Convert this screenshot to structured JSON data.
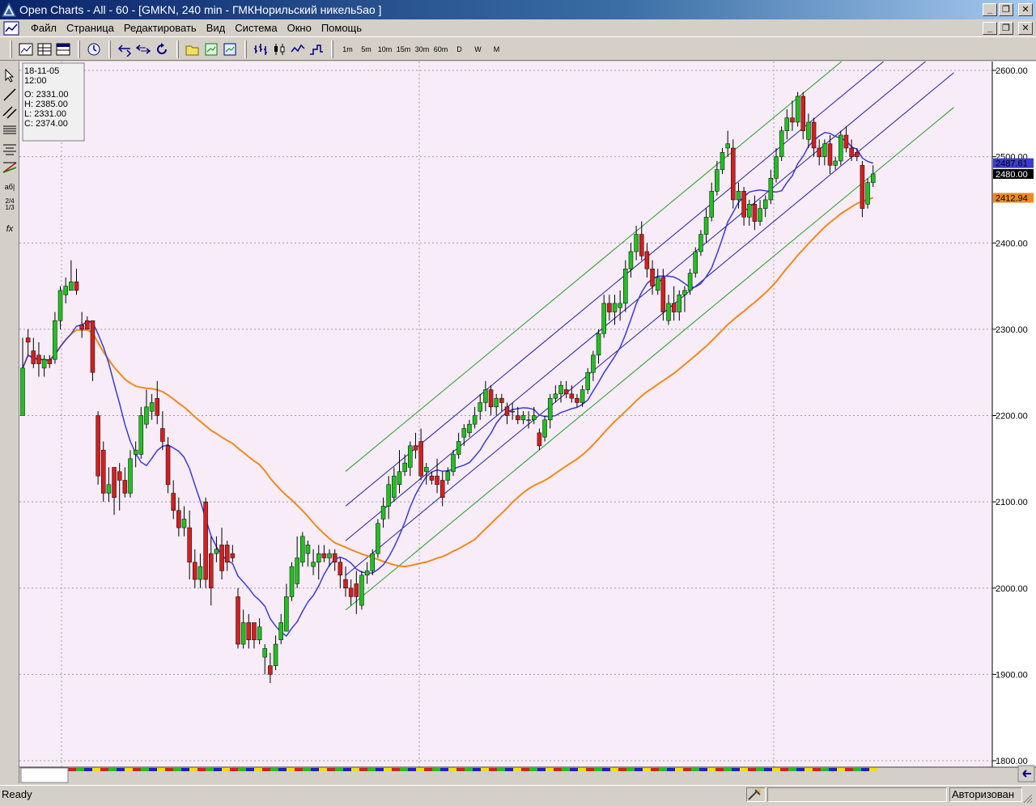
{
  "window": {
    "title": "Open Charts - All - 60 - [GMKN, 240 min - ГМКНорильский никель5ао ]"
  },
  "menu": {
    "items": [
      "Файл",
      "Страница",
      "Редактировать",
      "Вид",
      "Система",
      "Окно",
      "Помощь"
    ]
  },
  "toolbar": {
    "timeframes": [
      "1m",
      "5m",
      "10m",
      "15m",
      "30m",
      "60m",
      "D",
      "W",
      "M"
    ]
  },
  "lefttools": {
    "text_tool_label": "аб|",
    "fib_tool_label": "2/4\n1/3",
    "func_tool_label": "fx"
  },
  "ohlc_box": {
    "date": "18-11-05",
    "time": "12:00",
    "open": "O: 2331.00",
    "high": "H: 2385.00",
    "low": "L: 2331.00",
    "close": "C: 2374.00"
  },
  "price_labels": {
    "blue_ma": "2487.61",
    "last_price": "2480.00",
    "orange_ma": "2412.94"
  },
  "status": {
    "ready": "Ready",
    "auth": "Авторизован"
  },
  "chart_data": {
    "type": "candlestick",
    "ylim": [
      1800,
      2610
    ],
    "y_ticks": [
      "2600.00",
      "2500.00",
      "2400.00",
      "2300.00",
      "2200.00",
      "2100.00",
      "2000.00",
      "1900.00",
      "1800.00"
    ],
    "colors": {
      "up": "#22c022",
      "down": "#d22020",
      "background": "#f7ecf7",
      "blue_ma": "#3b3bd4",
      "orange_ma": "#f08a1e",
      "channel_inner": "#2020a0",
      "channel_outer": "#20a020"
    },
    "candles": [
      [
        2200,
        2290,
        2220,
        2255
      ],
      [
        2290,
        2300,
        2270,
        2285
      ],
      [
        2275,
        2290,
        2255,
        2260
      ],
      [
        2270,
        2285,
        2245,
        2260
      ],
      [
        2255,
        2270,
        2245,
        2265
      ],
      [
        2265,
        2270,
        2255,
        2260
      ],
      [
        2265,
        2320,
        2260,
        2310
      ],
      [
        2310,
        2350,
        2300,
        2345
      ],
      [
        2340,
        2360,
        2330,
        2350
      ],
      [
        2345,
        2380,
        2345,
        2355
      ],
      [
        2355,
        2370,
        2340,
        2345
      ],
      [
        2305,
        2320,
        2290,
        2300
      ],
      [
        2310,
        2315,
        2300,
        2300
      ],
      [
        2310,
        2310,
        2240,
        2250
      ],
      [
        2200,
        2205,
        2120,
        2130
      ],
      [
        2160,
        2170,
        2100,
        2110
      ],
      [
        2110,
        2140,
        2100,
        2120
      ],
      [
        2140,
        2140,
        2085,
        2105
      ],
      [
        2135,
        2145,
        2090,
        2125
      ],
      [
        2125,
        2140,
        2105,
        2110
      ],
      [
        2110,
        2160,
        2105,
        2150
      ],
      [
        2155,
        2170,
        2140,
        2160
      ],
      [
        2155,
        2210,
        2150,
        2200
      ],
      [
        2190,
        2230,
        2185,
        2210
      ],
      [
        2205,
        2225,
        2195,
        2215
      ],
      [
        2220,
        2240,
        2190,
        2200
      ],
      [
        2185,
        2205,
        2160,
        2170
      ],
      [
        2165,
        2175,
        2110,
        2120
      ],
      [
        2110,
        2125,
        2080,
        2090
      ],
      [
        2090,
        2105,
        2060,
        2070
      ],
      [
        2070,
        2095,
        2060,
        2080
      ],
      [
        2070,
        2090,
        2010,
        2030
      ],
      [
        2030,
        2045,
        2000,
        2010
      ],
      [
        2010,
        2040,
        2000,
        2025
      ],
      [
        2100,
        2105,
        2000,
        2010
      ],
      [
        2040,
        2060,
        1980,
        2000
      ],
      [
        2040,
        2060,
        2030,
        2045
      ],
      [
        2050,
        2070,
        2010,
        2020
      ],
      [
        2050,
        2055,
        2020,
        2030
      ],
      [
        2040,
        2050,
        2030,
        2035
      ],
      [
        1990,
        2000,
        1930,
        1935
      ],
      [
        1935,
        1975,
        1930,
        1960
      ],
      [
        1960,
        1970,
        1930,
        1940
      ],
      [
        1960,
        1960,
        1930,
        1940
      ],
      [
        1940,
        1965,
        1935,
        1955
      ],
      [
        1920,
        1935,
        1900,
        1930
      ],
      [
        1910,
        1925,
        1890,
        1900
      ],
      [
        1910,
        1945,
        1905,
        1935
      ],
      [
        1940,
        1970,
        1935,
        1960
      ],
      [
        1950,
        2005,
        1950,
        1990
      ],
      [
        1990,
        2030,
        1985,
        2025
      ],
      [
        2005,
        2060,
        2000,
        2035
      ],
      [
        2030,
        2065,
        2025,
        2060
      ],
      [
        2040,
        2055,
        2025,
        2050
      ],
      [
        2025,
        2045,
        2015,
        2030
      ],
      [
        2030,
        2050,
        2010,
        2040
      ],
      [
        2040,
        2050,
        2030,
        2035
      ],
      [
        2035,
        2045,
        2025,
        2040
      ],
      [
        2040,
        2045,
        2020,
        2030
      ],
      [
        2030,
        2035,
        2000,
        2015
      ],
      [
        2010,
        2025,
        1990,
        2000
      ],
      [
        2000,
        2010,
        1980,
        1990
      ],
      [
        2005,
        2020,
        1970,
        1990
      ],
      [
        1980,
        2020,
        1975,
        2015
      ],
      [
        2015,
        2030,
        2005,
        2020
      ],
      [
        2020,
        2045,
        2015,
        2040
      ],
      [
        2040,
        2080,
        2035,
        2075
      ],
      [
        2080,
        2105,
        2070,
        2095
      ],
      [
        2095,
        2130,
        2080,
        2120
      ],
      [
        2105,
        2140,
        2100,
        2130
      ],
      [
        2120,
        2160,
        2110,
        2135
      ],
      [
        2135,
        2155,
        2130,
        2145
      ],
      [
        2140,
        2170,
        2130,
        2165
      ],
      [
        2165,
        2180,
        2150,
        2160
      ],
      [
        2170,
        2185,
        2125,
        2130
      ],
      [
        2135,
        2145,
        2120,
        2140
      ],
      [
        2130,
        2135,
        2120,
        2125
      ],
      [
        2130,
        2150,
        2110,
        2120
      ],
      [
        2125,
        2135,
        2095,
        2105
      ],
      [
        2125,
        2140,
        2120,
        2135
      ],
      [
        2135,
        2160,
        2130,
        2155
      ],
      [
        2155,
        2180,
        2150,
        2170
      ],
      [
        2175,
        2190,
        2165,
        2185
      ],
      [
        2180,
        2195,
        2175,
        2190
      ],
      [
        2190,
        2210,
        2185,
        2200
      ],
      [
        2205,
        2225,
        2195,
        2215
      ],
      [
        2215,
        2240,
        2205,
        2230
      ],
      [
        2230,
        2235,
        2200,
        2210
      ],
      [
        2210,
        2225,
        2200,
        2220
      ],
      [
        2220,
        2225,
        2205,
        2215
      ],
      [
        2210,
        2215,
        2190,
        2200
      ],
      [
        2205,
        2215,
        2195,
        2205
      ],
      [
        2200,
        2210,
        2190,
        2195
      ],
      [
        2195,
        2205,
        2190,
        2200
      ],
      [
        2195,
        2205,
        2185,
        2195
      ],
      [
        2195,
        2210,
        2190,
        2200
      ],
      [
        2180,
        2185,
        2160,
        2165
      ],
      [
        2175,
        2200,
        2170,
        2195
      ],
      [
        2195,
        2225,
        2185,
        2220
      ],
      [
        2220,
        2235,
        2215,
        2225
      ],
      [
        2225,
        2240,
        2215,
        2235
      ],
      [
        2230,
        2240,
        2220,
        2225
      ],
      [
        2225,
        2235,
        2215,
        2220
      ],
      [
        2220,
        2225,
        2210,
        2215
      ],
      [
        2215,
        2235,
        2210,
        2230
      ],
      [
        2230,
        2255,
        2225,
        2250
      ],
      [
        2250,
        2275,
        2240,
        2270
      ],
      [
        2270,
        2300,
        2260,
        2295
      ],
      [
        2295,
        2340,
        2290,
        2330
      ],
      [
        2330,
        2340,
        2310,
        2320
      ],
      [
        2320,
        2340,
        2305,
        2330
      ],
      [
        2325,
        2345,
        2310,
        2330
      ],
      [
        2330,
        2380,
        2320,
        2370
      ],
      [
        2370,
        2400,
        2360,
        2390
      ],
      [
        2390,
        2420,
        2380,
        2410
      ],
      [
        2410,
        2425,
        2380,
        2385
      ],
      [
        2390,
        2400,
        2360,
        2370
      ],
      [
        2370,
        2380,
        2340,
        2350
      ],
      [
        2345,
        2370,
        2340,
        2360
      ],
      [
        2360,
        2370,
        2310,
        2320
      ],
      [
        2310,
        2340,
        2305,
        2330
      ],
      [
        2330,
        2350,
        2310,
        2320
      ],
      [
        2320,
        2345,
        2310,
        2340
      ],
      [
        2340,
        2350,
        2320,
        2345
      ],
      [
        2345,
        2370,
        2340,
        2365
      ],
      [
        2365,
        2395,
        2360,
        2390
      ],
      [
        2390,
        2415,
        2385,
        2410
      ],
      [
        2410,
        2440,
        2400,
        2430
      ],
      [
        2430,
        2470,
        2425,
        2460
      ],
      [
        2460,
        2495,
        2455,
        2485
      ],
      [
        2485,
        2510,
        2480,
        2505
      ],
      [
        2510,
        2530,
        2500,
        2515
      ],
      [
        2510,
        2520,
        2440,
        2450
      ],
      [
        2450,
        2470,
        2440,
        2460
      ],
      [
        2460,
        2465,
        2420,
        2430
      ],
      [
        2430,
        2450,
        2420,
        2445
      ],
      [
        2445,
        2455,
        2415,
        2425
      ],
      [
        2425,
        2450,
        2420,
        2440
      ],
      [
        2440,
        2455,
        2430,
        2450
      ],
      [
        2450,
        2485,
        2445,
        2475
      ],
      [
        2475,
        2510,
        2470,
        2500
      ],
      [
        2500,
        2535,
        2495,
        2530
      ],
      [
        2530,
        2555,
        2520,
        2545
      ],
      [
        2545,
        2565,
        2530,
        2540
      ],
      [
        2540,
        2575,
        2535,
        2570
      ],
      [
        2570,
        2575,
        2520,
        2530
      ],
      [
        2520,
        2550,
        2510,
        2540
      ],
      [
        2540,
        2545,
        2500,
        2510
      ],
      [
        2510,
        2520,
        2490,
        2500
      ],
      [
        2500,
        2520,
        2490,
        2515
      ],
      [
        2515,
        2525,
        2480,
        2490
      ],
      [
        2490,
        2500,
        2485,
        2495
      ],
      [
        2495,
        2530,
        2490,
        2525
      ],
      [
        2525,
        2535,
        2505,
        2510
      ],
      [
        2510,
        2520,
        2495,
        2500
      ],
      [
        2505,
        2510,
        2495,
        2500
      ],
      [
        2490,
        2495,
        2430,
        2440
      ],
      [
        2445,
        2475,
        2440,
        2470
      ],
      [
        2470,
        2490,
        2465,
        2480
      ]
    ]
  }
}
